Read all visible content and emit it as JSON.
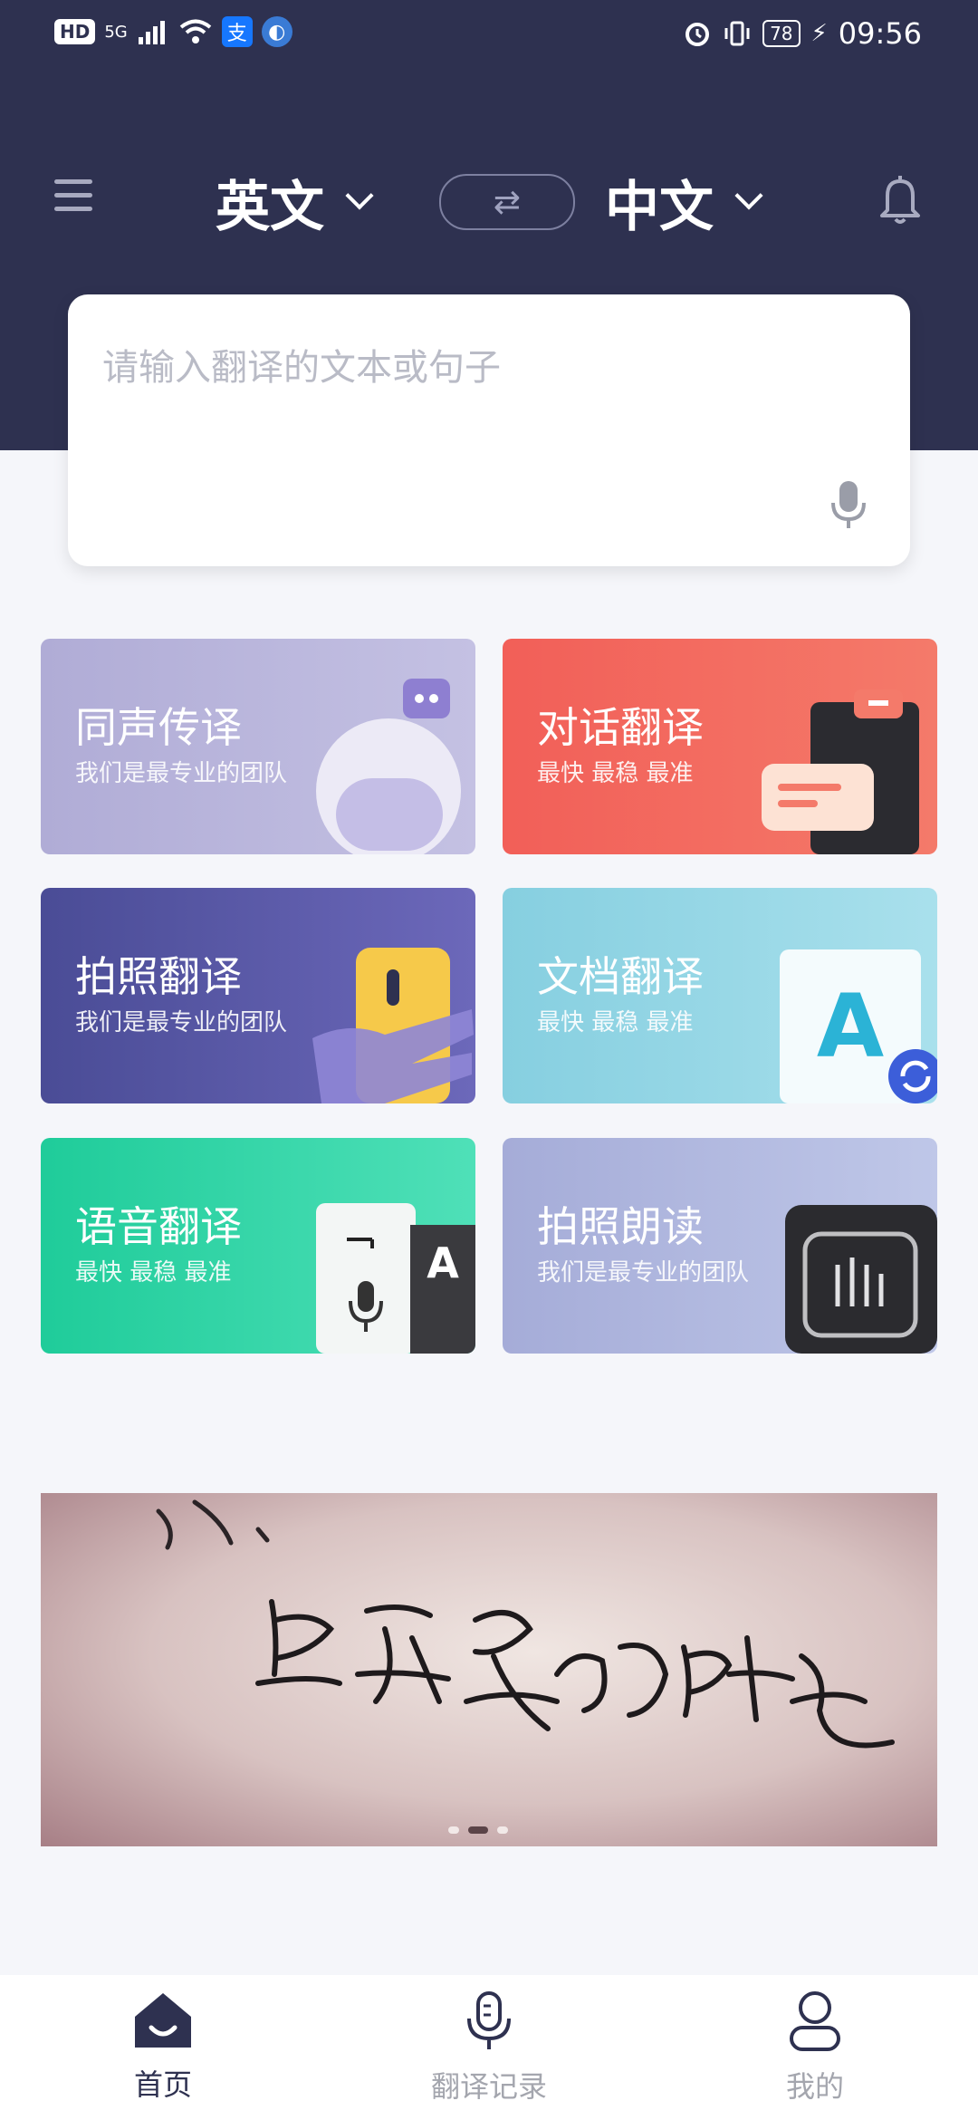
{
  "status_bar": {
    "left_badge": "HD",
    "network": "5G",
    "app_alipay": "支",
    "battery": "78",
    "time": "09:56"
  },
  "header": {
    "source_lang": "英文",
    "target_lang": "中文",
    "swap_glyph": "⇄"
  },
  "input": {
    "placeholder": "请输入翻译的文本或句子"
  },
  "features": [
    {
      "title": "同声传译",
      "subtitle": "我们是最专业的团队"
    },
    {
      "title": "对话翻译",
      "subtitle": "最快 最稳 最准"
    },
    {
      "title": "拍照翻译",
      "subtitle": "我们是最专业的团队"
    },
    {
      "title": "文档翻译",
      "subtitle": "最快 最稳 最准"
    },
    {
      "title": "语音翻译",
      "subtitle": "最快 最稳 最准"
    },
    {
      "title": "拍照朗读",
      "subtitle": "我们是最专业的团队"
    }
  ],
  "banner": {
    "slides": 3,
    "active_slide": 2
  },
  "bottom_nav": {
    "items": [
      {
        "label": "首页",
        "icon": "home-icon",
        "active": true
      },
      {
        "label": "翻译记录",
        "icon": "microphone-icon",
        "active": false
      },
      {
        "label": "我的",
        "icon": "profile-icon",
        "active": false
      }
    ]
  },
  "colors": {
    "header_bg": "#2e3150",
    "card_simultaneous": "#b1aed6",
    "card_dialogue": "#f2655b",
    "card_photo": "#4f51a0",
    "card_document": "#8fd2e2",
    "card_voice": "#2dd3a6",
    "card_read_aloud": "#a9b0da"
  }
}
